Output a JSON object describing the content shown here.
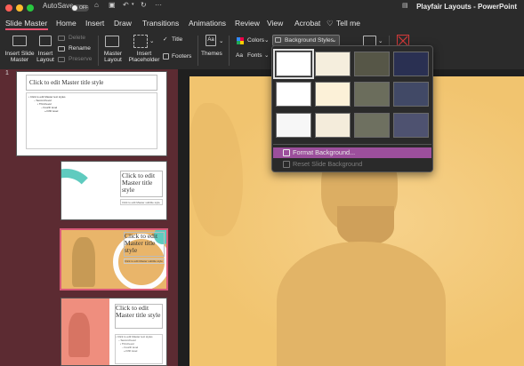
{
  "app": {
    "autosave_label": "AutoSave",
    "autosave_state": "OFF",
    "document_title": "Playfair Layouts - PowerPoint",
    "quick_access": {
      "more_label": "···"
    }
  },
  "tabs": [
    {
      "label": "Slide Master"
    },
    {
      "label": "Home"
    },
    {
      "label": "Insert"
    },
    {
      "label": "Draw"
    },
    {
      "label": "Transitions"
    },
    {
      "label": "Animations"
    },
    {
      "label": "Review"
    },
    {
      "label": "View"
    },
    {
      "label": "Acrobat"
    },
    {
      "label": "Tell me"
    }
  ],
  "ribbon": {
    "insert_slide_master": "Insert Slide Master",
    "insert_layout": "Insert Layout",
    "delete": "Delete",
    "rename": "Rename",
    "preserve": "Preserve",
    "master_layout": "Master Layout",
    "insert_placeholder": "Insert Placeholder",
    "title": "Title",
    "footers": "Footers",
    "themes": "Themes",
    "colors": "Colors",
    "fonts": "Fonts",
    "background_styles": "Background Styles",
    "font_icon_text": "Aa",
    "checkmark": "✓"
  },
  "background_styles_menu": {
    "swatches": [
      {
        "color": "#ffffff",
        "selected": true
      },
      {
        "color": "#f5eedd"
      },
      {
        "color": "#565647"
      },
      {
        "color": "#2a3052"
      },
      {
        "color": "#ffffff"
      },
      {
        "color": "#fcf1d8"
      },
      {
        "color": "#6b6d5c"
      },
      {
        "color": "#414966"
      },
      {
        "color": "#f7f7f7"
      },
      {
        "color": "#f4ecdb"
      },
      {
        "color": "#6e7060"
      },
      {
        "color": "#4e5270"
      }
    ],
    "format_background": "Format Background...",
    "reset_slide_background": "Reset Slide Background"
  },
  "thumbnails": {
    "slide_number": "1",
    "master": {
      "title": "Click to edit Master title style",
      "body": [
        "• Click to edit Master text styles",
        "– Second level",
        "• Third level",
        "– Fourth level",
        "» Fifth level"
      ]
    },
    "layout_title": "Click to edit Master title style",
    "layout_subtitle": "Click to edit Master subtitle style"
  },
  "colors": {
    "accent_tab": "#e84f6f",
    "slide_background": "#f1c46f",
    "thumbnail_pane": "#5c2b32",
    "menu_highlight": "#9c4f9c"
  }
}
